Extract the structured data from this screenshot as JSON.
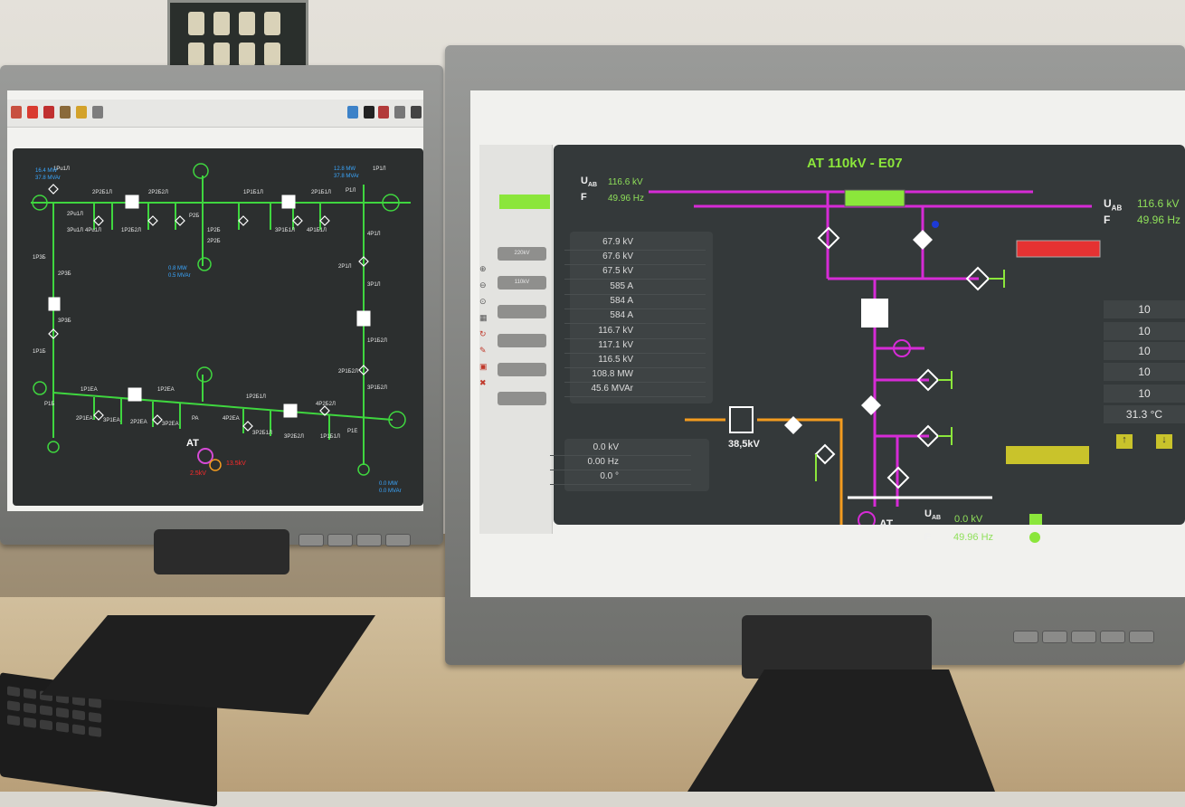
{
  "left_monitor": {
    "labels": [
      "1Pu1Л",
      "2Pu1Л",
      "3Pu1Л",
      "4Pu1Л",
      "2P2Б1Л",
      "1P2Б1Л",
      "3P2Б1Л",
      "2P2Б2Л",
      "1P2Б2Л",
      "3P2Б2Л",
      "4P2Б2Л",
      "P2Б",
      "1P2Б",
      "2P2Б",
      "1P1Б1Л",
      "2P1Б1Л",
      "3P1Б1Л",
      "4P1Б1Л",
      "1P1Б2Л",
      "2P1Б2Л",
      "3P1Б2Л",
      "1P3Б",
      "2P3Б",
      "3P3Б",
      "1P1Б",
      "P1Л",
      "1P1Л",
      "2P1Л",
      "3P1Л",
      "4P1Л",
      "1P1ЕA",
      "2P1ЕA",
      "3P1ЕA",
      "1P2ЕA",
      "2P2ЕA",
      "3P2ЕA",
      "4P2ЕA",
      "P1Б",
      "P1Е",
      "PA"
    ],
    "readouts": [
      "12.8 MW",
      "37.8 MVAr",
      "0.8 MW",
      "0.5 MVAr",
      "0.0 MW",
      "0.0 MVAr",
      "16.4 MW",
      "37.8 MVAr"
    ],
    "transformer_label": "AT",
    "transformer_readouts": [
      "13.5kV",
      "2.5kV"
    ]
  },
  "right_monitor": {
    "title": "AT 110kV - E07",
    "sidebar_buttons": [
      "220kV",
      "110kV",
      "",
      "",
      "",
      ""
    ],
    "left_measurements": [
      "67.9 kV",
      "67.6 kV",
      "67.5 kV",
      "585 A",
      "584 A",
      "584 A",
      "116.7 kV",
      "117.1 kV",
      "116.5 kV",
      "108.8 MW",
      "45.6 MVAr"
    ],
    "lower_measurements": [
      "0.0 kV",
      "0.00 Hz",
      "0.0 °"
    ],
    "top_readout": {
      "u_label": "U",
      "u_sub": "AB",
      "u_value": "116.6 kV",
      "f_label": "F",
      "f_value": "49.96 Hz"
    },
    "right_readout": {
      "u_label": "U",
      "u_sub": "AB",
      "u_value": "116.6 kV",
      "f_label": "F",
      "f_value": "49.96 Hz"
    },
    "bottom_readout": {
      "u_label": "U",
      "u_sub": "AB",
      "u_value": "0.0 kV",
      "f_label": "F",
      "f_value": "49.96 Hz"
    },
    "transformer_label": "AT",
    "feeder_label": "38,5kV",
    "right_values": [
      "10",
      "10",
      "10",
      "10",
      "10",
      "31.3 °C"
    ],
    "colors": {
      "busbar": "#d62bd6",
      "green_bar": "#8be63b",
      "red_bar": "#e53232",
      "yellow_bar": "#c9c32b",
      "orange_line": "#f39c1f"
    }
  }
}
